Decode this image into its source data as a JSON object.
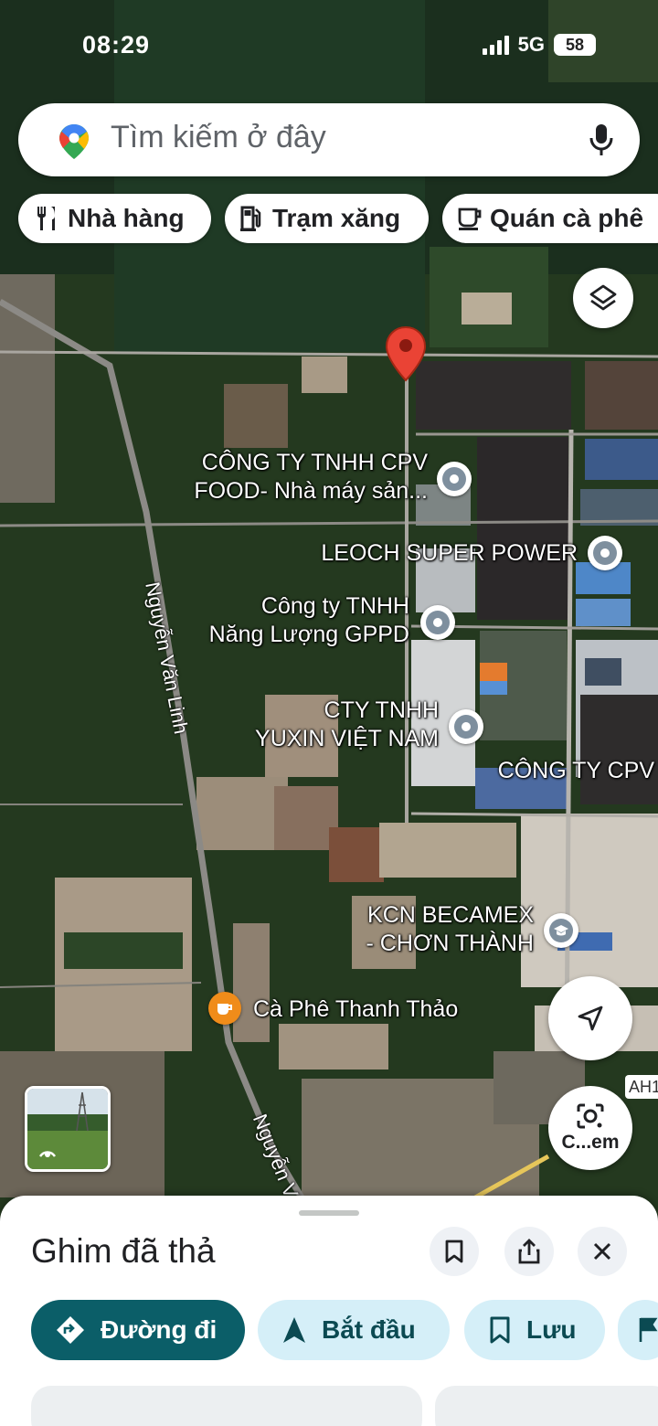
{
  "status_bar": {
    "time": "08:29",
    "network": "5G",
    "battery": "58"
  },
  "search": {
    "placeholder": "Tìm kiếm ở đây"
  },
  "chips": [
    {
      "label": "Nhà hàng",
      "icon": "restaurant-icon"
    },
    {
      "label": "Trạm xăng",
      "icon": "gas-station-icon"
    },
    {
      "label": "Quán cà phê",
      "icon": "cafe-icon"
    }
  ],
  "map": {
    "pois": [
      {
        "line1": "CÔNG TY TNHH CPV",
        "line2": "FOOD- Nhà máy sản..."
      },
      {
        "line1": "LEOCH SUPER POWER"
      },
      {
        "line1": "Công ty TNHH",
        "line2": "Năng Lượng GPPD"
      },
      {
        "line1": "CTY TNHH",
        "line2": "YUXIN VIỆT NAM"
      },
      {
        "line1": "CÔNG TY CPV"
      },
      {
        "line1": "KCN BECAMEX",
        "line2": "- CHƠN THÀNH"
      },
      {
        "line1": "Cà Phê Thanh Thảo"
      }
    ],
    "roads": [
      "Nguyễn Văn Linh",
      "Nguyễn Vă"
    ],
    "highway_badge": "AH1",
    "lens_label": "C...em"
  },
  "sheet": {
    "title": "Ghim đã thả",
    "actions": [
      {
        "label": "Đường đi"
      },
      {
        "label": "Bắt đầu"
      },
      {
        "label": "Lưu"
      }
    ]
  },
  "colors": {
    "primary": "#0b5e68",
    "secondary_bg": "#d5eff8",
    "pin_red": "#ea4335",
    "cafe_orange": "#f08c1a"
  }
}
